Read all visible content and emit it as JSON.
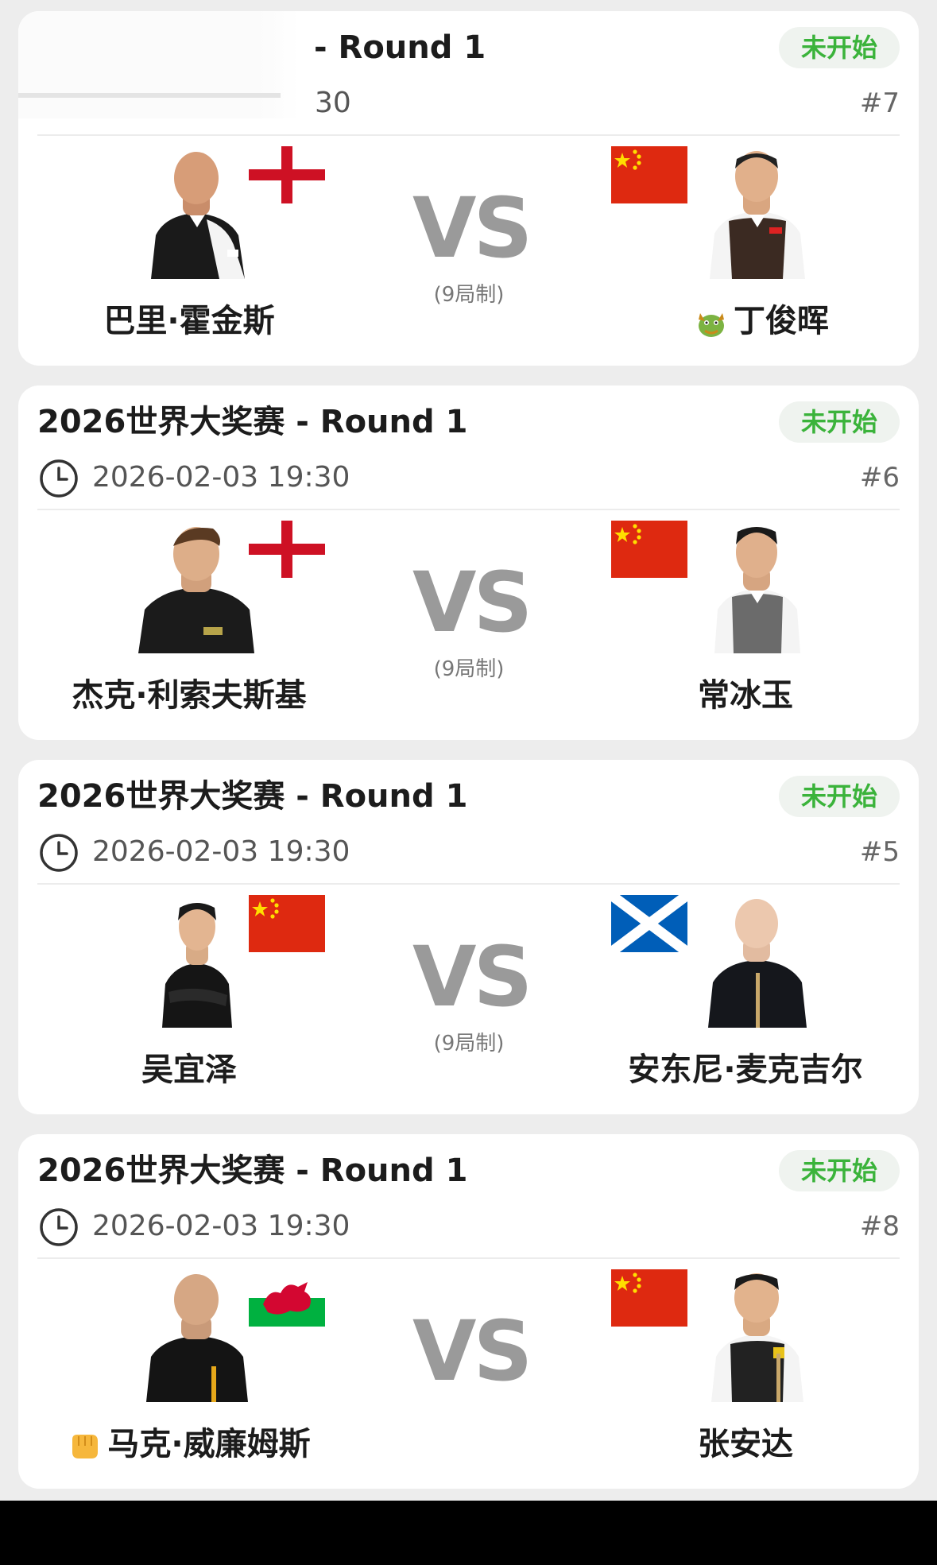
{
  "status_color": "#3bb33b",
  "cards": [
    {
      "title": "- Round 1",
      "status": "未开始",
      "datetime": "30",
      "number": "#7",
      "vs": "VS",
      "format": "(9局制)",
      "left": {
        "name": "巴里·霍金斯",
        "flag": "england-flag"
      },
      "right": {
        "name": "丁俊晖",
        "flag": "china-flag",
        "emoji": "dragon-icon"
      }
    },
    {
      "title": "2026世界大奖赛 - Round 1",
      "status": "未开始",
      "datetime": "2026-02-03 19:30",
      "number": "#6",
      "vs": "VS",
      "format": "(9局制)",
      "left": {
        "name": "杰克·利索夫斯基",
        "flag": "england-flag"
      },
      "right": {
        "name": "常冰玉",
        "flag": "china-flag"
      }
    },
    {
      "title": "2026世界大奖赛 - Round 1",
      "status": "未开始",
      "datetime": "2026-02-03 19:30",
      "number": "#5",
      "vs": "VS",
      "format": "(9局制)",
      "left": {
        "name": "吴宜泽",
        "flag": "china-flag"
      },
      "right": {
        "name": "安东尼·麦克吉尔",
        "flag": "scotland-flag"
      }
    },
    {
      "title": "2026世界大奖赛 - Round 1",
      "status": "未开始",
      "datetime": "2026-02-03 19:30",
      "number": "#8",
      "vs": "VS",
      "left": {
        "name": "马克·威廉姆斯",
        "flag": "wales-flag",
        "emoji": "fist-icon"
      },
      "right": {
        "name": "张安达",
        "flag": "china-flag"
      }
    }
  ]
}
